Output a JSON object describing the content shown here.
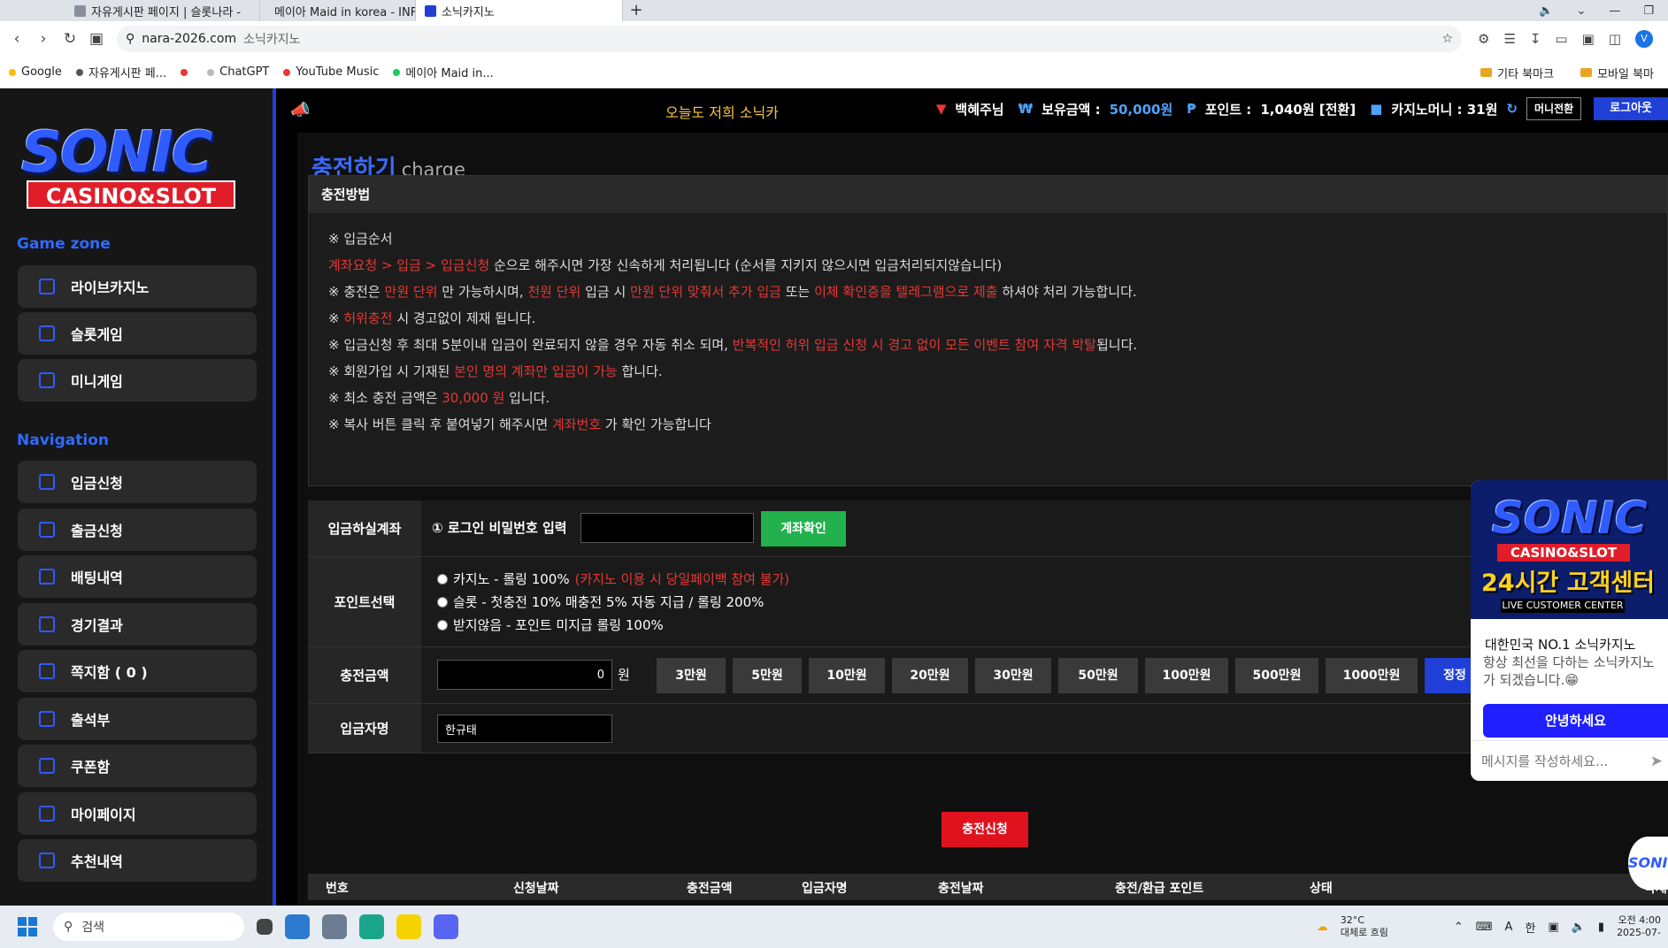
{
  "browser": {
    "tabs": [
      {
        "label": "자유게시판 페이지 | 슬롯나라 - "
      },
      {
        "label": "메이아 Maid in korea - INFP 소"
      },
      {
        "label": "소닉카지노"
      }
    ],
    "new_tab": "+",
    "url": "nara-2026.com",
    "page_title": "소닉카지노",
    "profile_initial": "V",
    "bookmarks": [
      {
        "label": "Google"
      },
      {
        "label": "자유게시판 페..."
      },
      {
        "label": ""
      },
      {
        "label": "ChatGPT"
      },
      {
        "label": "YouTube Music"
      },
      {
        "label": "메이아 Maid in..."
      }
    ],
    "bookmark_folders": [
      {
        "label": "기타 북마크"
      },
      {
        "label": "모바일 북마"
      }
    ]
  },
  "site": {
    "logo": {
      "main": "SONIC",
      "sub": "CASINO&SLOT"
    },
    "game_zone_title": "Game zone",
    "game_zone": [
      {
        "label": "라이브카지노"
      },
      {
        "label": "슬롯게임"
      },
      {
        "label": "미니게임"
      }
    ],
    "navigation_title": "Navigation",
    "navigation": [
      {
        "label": "입금신청"
      },
      {
        "label": "출금신청"
      },
      {
        "label": "배팅내역"
      },
      {
        "label": "경기결과"
      },
      {
        "label": "쪽지함 ( 0 )"
      },
      {
        "label": "출석부"
      },
      {
        "label": "쿠폰함"
      },
      {
        "label": "마이페이지"
      },
      {
        "label": "추천내역"
      }
    ],
    "topbar": {
      "marquee": "오늘도 저희 소닉카",
      "username": "백혜주님",
      "balance_label": "보유금액 :",
      "balance_value": "50,000원",
      "point_label": "포인트 :",
      "point_value": "1,040원 [전환]",
      "casino_label": "카지노머니 : 31원",
      "money_switch": "머니전환",
      "logout": "로그아웃"
    },
    "page": {
      "title": "충전하기",
      "title_en": "charge"
    },
    "method": {
      "head": "충전방법",
      "lines": [
        {
          "parts": [
            {
              "t": "※ 입금순서",
              "red": false
            }
          ]
        },
        {
          "parts": [
            {
              "t": "계좌요청 > 입금 > 입금신청",
              "red": true
            },
            {
              "t": " 순으로 해주시면 가장 신속하게 처리됩니다 (순서를 지키지 않으시면 입금처리되지않습니다)",
              "red": false
            }
          ]
        },
        {
          "parts": [
            {
              "t": "※ 충전은 ",
              "red": false
            },
            {
              "t": "만원 단위",
              "red": true
            },
            {
              "t": " 만 가능하시며, ",
              "red": false
            },
            {
              "t": "천원 단위",
              "red": true
            },
            {
              "t": " 입금 시 ",
              "red": false
            },
            {
              "t": "만원 단위 맞춰서 추가 입금",
              "red": true
            },
            {
              "t": " 또는 ",
              "red": false
            },
            {
              "t": "이체 확인증을 텔레그램으로 제출",
              "red": true
            },
            {
              "t": " 하셔야 처리 가능합니다.",
              "red": false
            }
          ]
        },
        {
          "parts": [
            {
              "t": "※ ",
              "red": false
            },
            {
              "t": "허위충전",
              "red": true
            },
            {
              "t": " 시 경고없이 제재 됩니다.",
              "red": false
            }
          ]
        },
        {
          "parts": [
            {
              "t": "※ 입금신청 후 최대 5분이내 입금이 완료되지 않을 경우 자동 취소 되며, ",
              "red": false
            },
            {
              "t": "반복적인 허위 입금 신청 시 경고 없이 모든 이벤트 참여 자격 박탈",
              "red": true
            },
            {
              "t": "됩니다.",
              "red": false
            }
          ]
        },
        {
          "parts": [
            {
              "t": "※ 회원가입 시 기재된 ",
              "red": false
            },
            {
              "t": "본인 명의 계좌만 입금이 가능",
              "red": true
            },
            {
              "t": " 합니다.",
              "red": false
            }
          ]
        },
        {
          "parts": [
            {
              "t": "※ 최소 충전 금액은 ",
              "red": false
            },
            {
              "t": "30,000 원",
              "red": true
            },
            {
              "t": " 입니다.",
              "red": false
            }
          ]
        },
        {
          "parts": [
            {
              "t": "※ 복사 버튼 클릭 후 붙여넣기 해주시면 ",
              "red": false
            },
            {
              "t": "계좌번호",
              "red": true
            },
            {
              "t": " 가 확인 가능합니다",
              "red": false
            }
          ]
        }
      ]
    },
    "form": {
      "account_label": "입금하실계좌",
      "account_prompt": "① 로그인 비밀번호 입력",
      "account_check": "계좌확인",
      "point_label": "포인트선택",
      "point_options": [
        {
          "text": "카지노 - 롤링 100% ",
          "note": "(카지노 이용 시 당일페이백 참여 불가)"
        },
        {
          "text": "슬롯 - 첫충전 10% 매충전 5% 자동 지급 / 롤링 200%",
          "note": ""
        },
        {
          "text": "받지않음 - 포인트 미지급 롤링 100%",
          "note": ""
        }
      ],
      "amount_label": "충전금액",
      "amount_value": "0",
      "amount_unit": "원",
      "amount_buttons": [
        {
          "label": "3만원"
        },
        {
          "label": "5만원"
        },
        {
          "label": "10만원"
        },
        {
          "label": "20만원"
        },
        {
          "label": "30만원"
        },
        {
          "label": "50만원"
        },
        {
          "label": "100만원"
        },
        {
          "label": "500만원"
        },
        {
          "label": "1000만원"
        },
        {
          "label": "정정"
        }
      ],
      "depositor_label": "입금자명",
      "depositor_value": "한규태",
      "submit": "충전신청"
    },
    "table_headers": [
      {
        "label": "번호"
      },
      {
        "label": "신청날짜"
      },
      {
        "label": "충전금액"
      },
      {
        "label": "입금자명"
      },
      {
        "label": "충전날짜"
      },
      {
        "label": "충전/환급 포인트"
      },
      {
        "label": "상태"
      },
      {
        "label": "삭제"
      }
    ],
    "chat": {
      "banner_main": "SONIC",
      "banner_sub": "CASINO&SLOT",
      "banner_24": "24시간 고객센터",
      "banner_lcc": "LIVE CUSTOMER CENTER",
      "name": "대한민국 NO.1 소닉카지노",
      "desc": "항상 최선을 다하는 소닉카지노가 되겠습니다.",
      "greet_button": "안녕하세요",
      "input_placeholder": "메시지를 작성하세요...",
      "bubble": "SONI"
    }
  },
  "taskbar": {
    "search_placeholder": "검색",
    "temperature": "32°C",
    "weather": "대체로 흐림",
    "ime_a": "A",
    "ime_han": "한",
    "time": "오전 4:00",
    "date": "2025-07-"
  }
}
